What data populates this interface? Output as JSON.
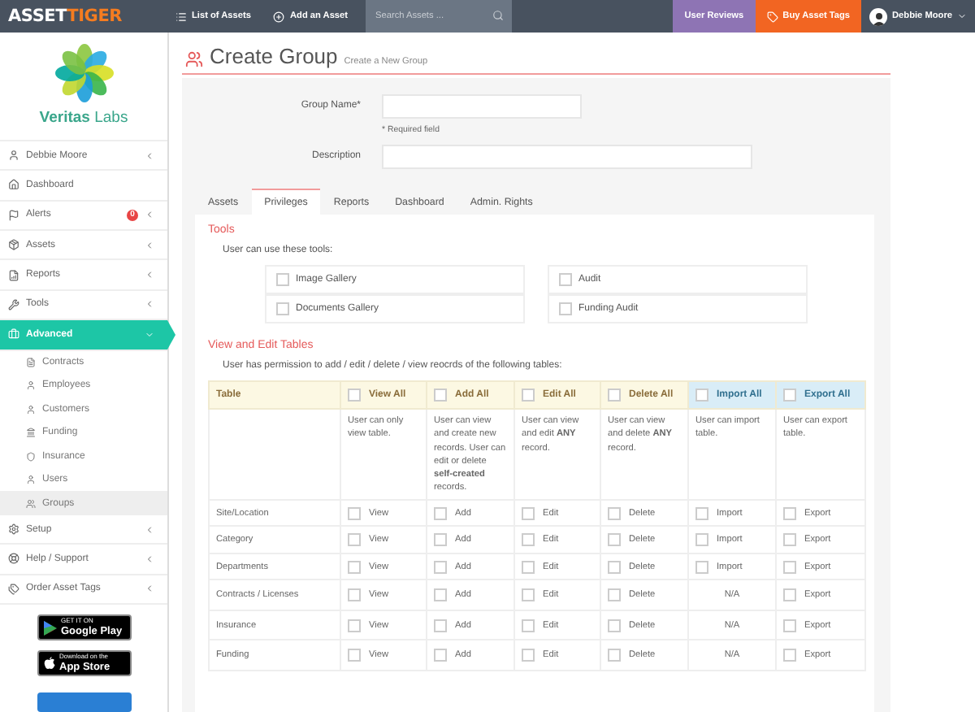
{
  "topbar": {
    "logo": {
      "first": "ASSET",
      "second": "TIGER"
    },
    "nav": [
      "List of Assets",
      "Add an Asset"
    ],
    "search": {
      "placeholder": "Search Assets ..."
    },
    "user_reviews": "User Reviews",
    "buy_tags": "Buy Asset Tags",
    "user": "Debbie Moore"
  },
  "sidebar": {
    "org": "**Veritas** Labs",
    "items": [
      {
        "kind": "menu",
        "label": "Debbie Moore",
        "expanded": false,
        "selected": false
      },
      {
        "kind": "link",
        "label": "Dashboard",
        "expanded": false,
        "selected": false
      },
      {
        "kind": "menu",
        "label": "Alerts",
        "badge": "0",
        "expanded": false,
        "selected": false
      },
      {
        "kind": "menu",
        "label": "Assets",
        "expanded": false,
        "selected": false
      },
      {
        "kind": "menu",
        "label": "Reports",
        "expanded": false,
        "selected": false
      },
      {
        "kind": "menu",
        "label": "Tools",
        "expanded": false,
        "selected": false
      },
      {
        "kind": "menu",
        "label": "Advanced",
        "expanded": true,
        "selected": true,
        "children": [
          {
            "label": "Contracts",
            "selected": false
          },
          {
            "label": "Employees",
            "selected": false
          },
          {
            "label": "Customers",
            "selected": false
          },
          {
            "label": "Funding",
            "selected": false
          },
          {
            "label": "Insurance",
            "selected": false
          },
          {
            "label": "Users",
            "selected": false
          },
          {
            "label": "Groups",
            "selected": true
          }
        ]
      },
      {
        "kind": "menu",
        "label": "Setup",
        "expanded": false,
        "selected": false
      },
      {
        "kind": "menu",
        "label": "Help / Support",
        "expanded": false,
        "selected": false
      },
      {
        "kind": "menu",
        "label": "Order Asset Tags",
        "expanded": false,
        "selected": false
      }
    ],
    "store_badges": [
      {
        "kind": "google",
        "small": "GET IT ON",
        "large": "Google Play"
      },
      {
        "kind": "apple",
        "small": "Download on the",
        "large": "App Store"
      }
    ]
  },
  "page": {
    "title": "Create Group",
    "subtitle": "Create a New Group",
    "form": [
      {
        "kind": "short",
        "label": "Group Name*",
        "hint": "* Required field"
      },
      {
        "kind": "long",
        "label": "Description"
      }
    ],
    "tabs": [
      {
        "label": "Assets",
        "selected": false
      },
      {
        "label": "Privileges",
        "selected": true
      },
      {
        "label": "Reports",
        "selected": false
      },
      {
        "label": "Dashboard",
        "selected": false
      },
      {
        "label": "Admin. Rights",
        "selected": false
      }
    ],
    "privileges": {
      "tools_heading": "Tools",
      "tools_intro": "User can use these tools:",
      "tools": [
        {
          "label": "Image Gallery",
          "checked": false
        },
        {
          "label": "Audit",
          "checked": false
        },
        {
          "label": "Documents Gallery",
          "checked": false
        },
        {
          "label": "Funding Audit",
          "checked": false
        }
      ],
      "tables_heading": "View and Edit Tables",
      "tables_intro": "User has permission to add / edit / delete / view reocrds of the following tables:",
      "table": {
        "columns": [
          {
            "kind": "plain",
            "label": "Table",
            "color": "#fcf8e3"
          },
          {
            "kind": "toggle",
            "label": "View All",
            "checked": false,
            "color": "#fcf8e3"
          },
          {
            "kind": "toggle",
            "label": "Add All",
            "checked": false,
            "color": "#fcf8e3"
          },
          {
            "kind": "toggle",
            "label": "Edit All",
            "checked": false,
            "color": "#fcf8e3"
          },
          {
            "kind": "toggle",
            "label": "Delete All",
            "checked": false,
            "color": "#fcf8e3"
          },
          {
            "kind": "toggle",
            "label": "Import All",
            "checked": false,
            "color": "#d9edf7"
          },
          {
            "kind": "toggle",
            "label": "Export All",
            "checked": false,
            "color": "#d9edf7"
          }
        ],
        "descriptions": [
          "User can only view table.",
          "User can view and create new records. User can edit or delete **self-created** records.",
          "User can view and edit **ANY** record.",
          "User can view and delete **ANY** record.",
          "User can import table.",
          "User can export table."
        ],
        "rows": [
          {
            "cells": [
              {
                "kind": "name",
                "label": "Site/Location"
              },
              {
                "kind": "check",
                "label": "View",
                "checked": false
              },
              {
                "kind": "check",
                "label": "Add",
                "checked": false
              },
              {
                "kind": "check",
                "label": "Edit",
                "checked": false
              },
              {
                "kind": "check",
                "label": "Delete",
                "checked": false
              },
              {
                "kind": "check",
                "label": "Import",
                "checked": false
              },
              {
                "kind": "check",
                "label": "Export",
                "checked": false
              }
            ]
          },
          {
            "cells": [
              {
                "kind": "name",
                "label": "Category"
              },
              {
                "kind": "check",
                "label": "View",
                "checked": false
              },
              {
                "kind": "check",
                "label": "Add",
                "checked": false
              },
              {
                "kind": "check",
                "label": "Edit",
                "checked": false
              },
              {
                "kind": "check",
                "label": "Delete",
                "checked": false
              },
              {
                "kind": "check",
                "label": "Import",
                "checked": false
              },
              {
                "kind": "check",
                "label": "Export",
                "checked": false
              }
            ]
          },
          {
            "cells": [
              {
                "kind": "name",
                "label": "Departments"
              },
              {
                "kind": "check",
                "label": "View",
                "checked": false
              },
              {
                "kind": "check",
                "label": "Add",
                "checked": false
              },
              {
                "kind": "check",
                "label": "Edit",
                "checked": false
              },
              {
                "kind": "check",
                "label": "Delete",
                "checked": false
              },
              {
                "kind": "check",
                "label": "Import",
                "checked": false
              },
              {
                "kind": "check",
                "label": "Export",
                "checked": false
              }
            ]
          },
          {
            "cells": [
              {
                "kind": "name",
                "label": "Contracts / Licenses"
              },
              {
                "kind": "check",
                "label": "View",
                "checked": false
              },
              {
                "kind": "check",
                "label": "Add",
                "checked": false
              },
              {
                "kind": "check",
                "label": "Edit",
                "checked": false
              },
              {
                "kind": "check",
                "label": "Delete",
                "checked": false
              },
              {
                "kind": "text",
                "label": "N/A"
              },
              {
                "kind": "check",
                "label": "Export",
                "checked": false
              }
            ]
          },
          {
            "cells": [
              {
                "kind": "name",
                "label": "Insurance"
              },
              {
                "kind": "check",
                "label": "View",
                "checked": false
              },
              {
                "kind": "check",
                "label": "Add",
                "checked": false
              },
              {
                "kind": "check",
                "label": "Edit",
                "checked": false
              },
              {
                "kind": "check",
                "label": "Delete",
                "checked": false
              },
              {
                "kind": "text",
                "label": "N/A"
              },
              {
                "kind": "check",
                "label": "Export",
                "checked": false
              }
            ]
          },
          {
            "cells": [
              {
                "kind": "name",
                "label": "Funding"
              },
              {
                "kind": "check",
                "label": "View",
                "checked": false
              },
              {
                "kind": "check",
                "label": "Add",
                "checked": false
              },
              {
                "kind": "check",
                "label": "Edit",
                "checked": false
              },
              {
                "kind": "check",
                "label": "Delete",
                "checked": false
              },
              {
                "kind": "text",
                "label": "N/A"
              },
              {
                "kind": "check",
                "label": "Export",
                "checked": false
              }
            ]
          }
        ]
      }
    }
  }
}
